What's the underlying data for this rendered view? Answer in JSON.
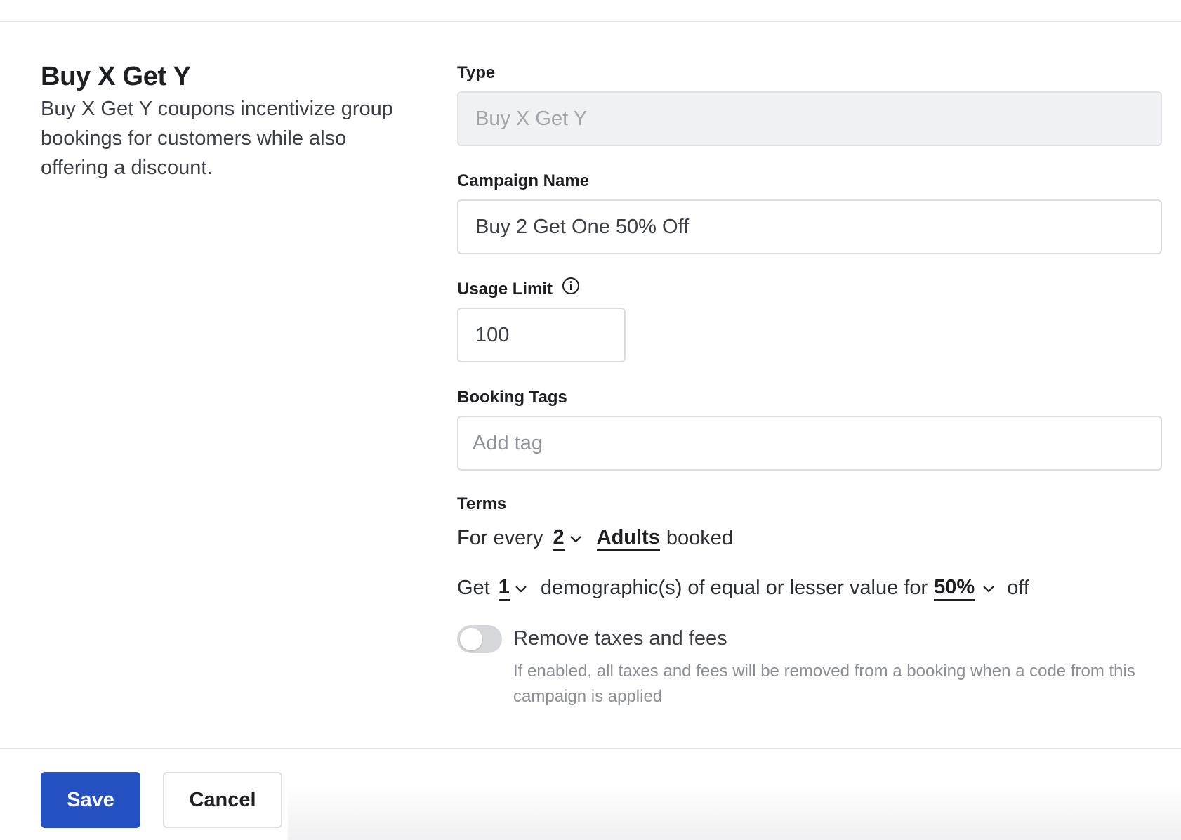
{
  "intro": {
    "title": "Buy X Get Y",
    "description": "Buy X Get Y coupons incentivize group bookings for customers while also offering a discount."
  },
  "type_field": {
    "label": "Type",
    "value": "Buy X Get Y"
  },
  "campaign_field": {
    "label": "Campaign Name",
    "value": "Buy 2 Get One 50% Off"
  },
  "usage_field": {
    "label": "Usage Limit",
    "value": "100",
    "icon": "info-icon"
  },
  "tags_field": {
    "label": "Booking Tags",
    "placeholder": "Add tag"
  },
  "terms": {
    "label": "Terms",
    "line1": {
      "prefix": "For every",
      "count": "2",
      "demographic": "Adults",
      "suffix": "booked"
    },
    "line2": {
      "prefix": "Get",
      "count": "1",
      "middle": "demographic(s) of equal or lesser value for",
      "discount": "50%",
      "suffix": "off"
    }
  },
  "taxes_toggle": {
    "label": "Remove taxes and fees",
    "enabled": false,
    "help": "If enabled, all taxes and fees will be removed from a booking when a code from this campaign is applied"
  },
  "actions": {
    "save_label": "Save",
    "cancel_label": "Cancel"
  },
  "colors": {
    "primary": "#2450c2",
    "border": "#dcdde0",
    "disabled_bg": "#f0f1f3"
  }
}
